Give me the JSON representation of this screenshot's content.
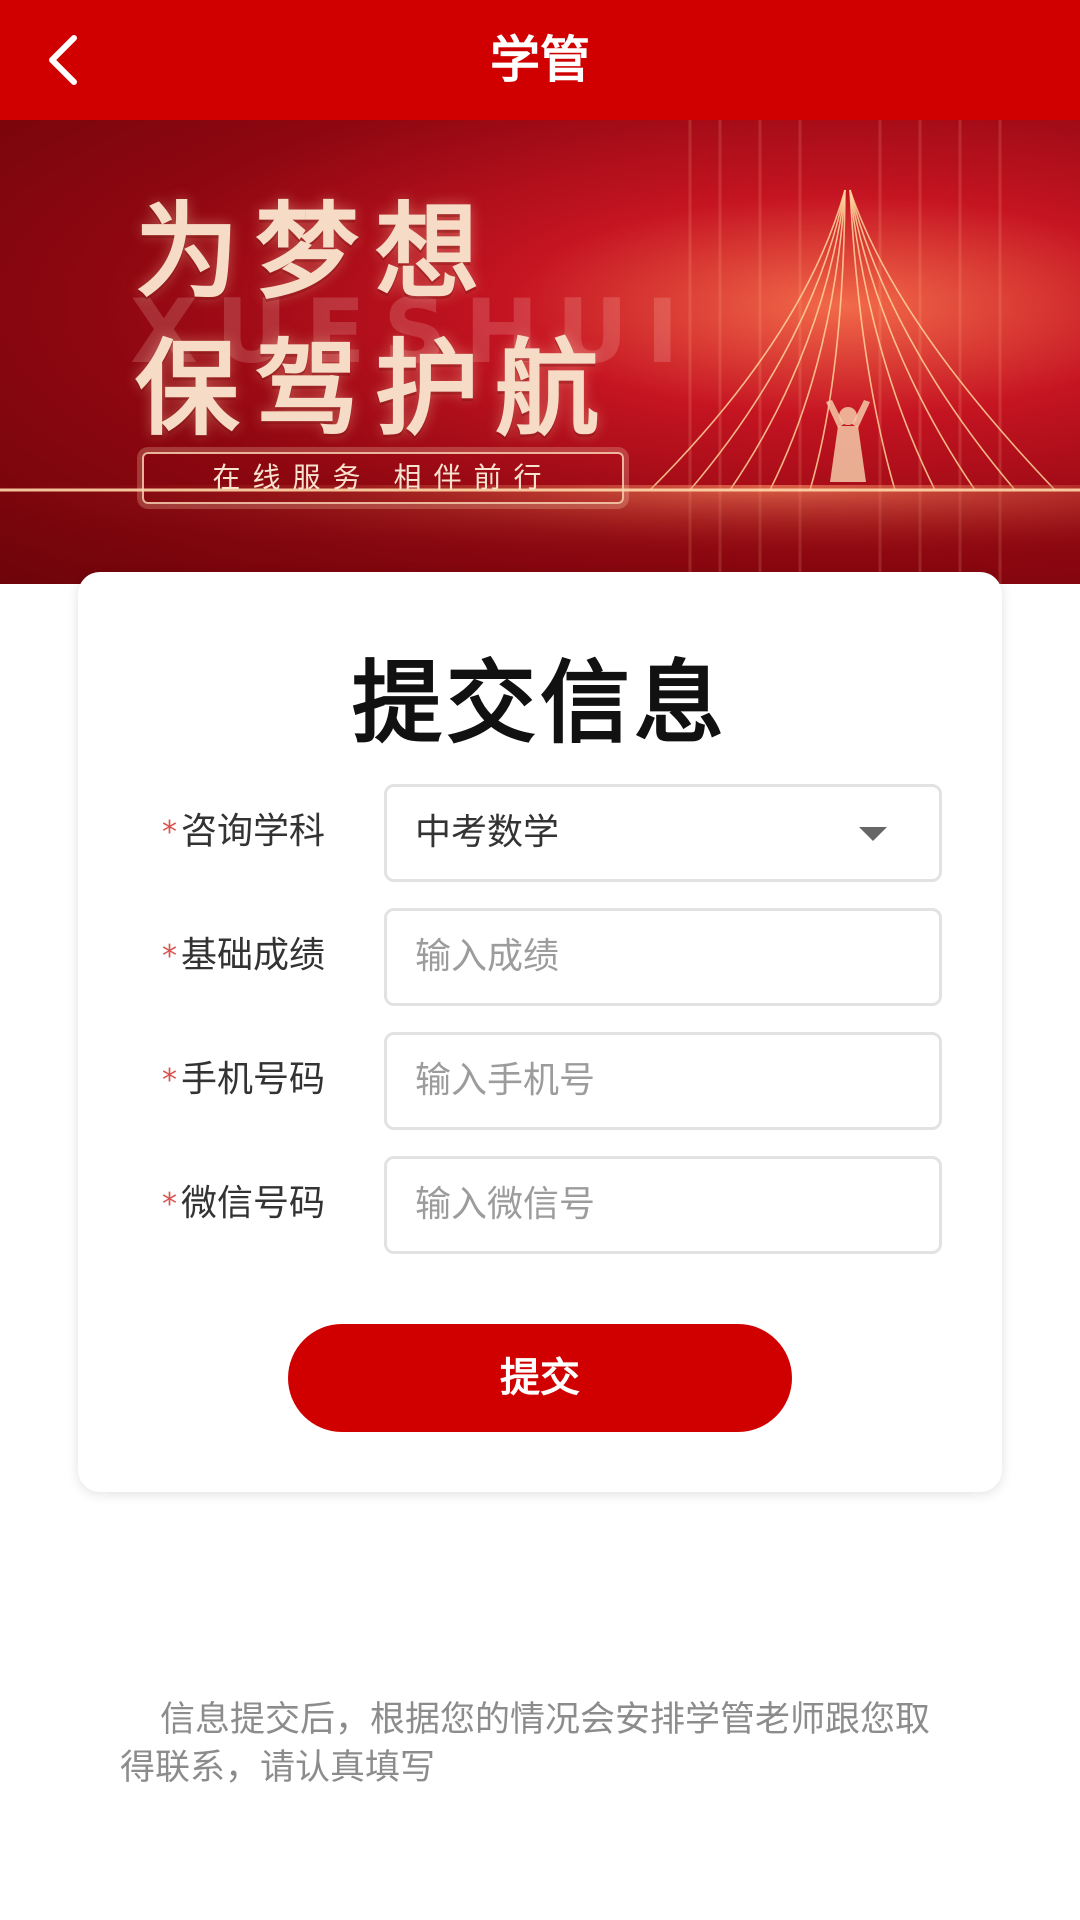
{
  "header": {
    "title": "学管",
    "back_icon": "chevron-left-icon"
  },
  "banner": {
    "slogan_line1": "为梦想",
    "slogan_line2": "保驾护航",
    "watermark": "XUESHUI",
    "tagline": "在线服务 相伴前行",
    "colors": {
      "primary": "#d00000",
      "gold": "#f6dcc6"
    }
  },
  "form": {
    "title": "提交信息",
    "required_mark": "*",
    "fields": {
      "subject": {
        "label": "咨询学科",
        "value": "中考数学"
      },
      "score": {
        "label": "基础成绩",
        "placeholder": "输入成绩"
      },
      "phone": {
        "label": "手机号码",
        "placeholder": "输入手机号"
      },
      "wechat": {
        "label": "微信号码",
        "placeholder": "输入微信号"
      }
    },
    "submit_label": "提交"
  },
  "note": {
    "text": "信息提交后，根据您的情况会安排学管老师跟您取得联系，请认真填写"
  }
}
